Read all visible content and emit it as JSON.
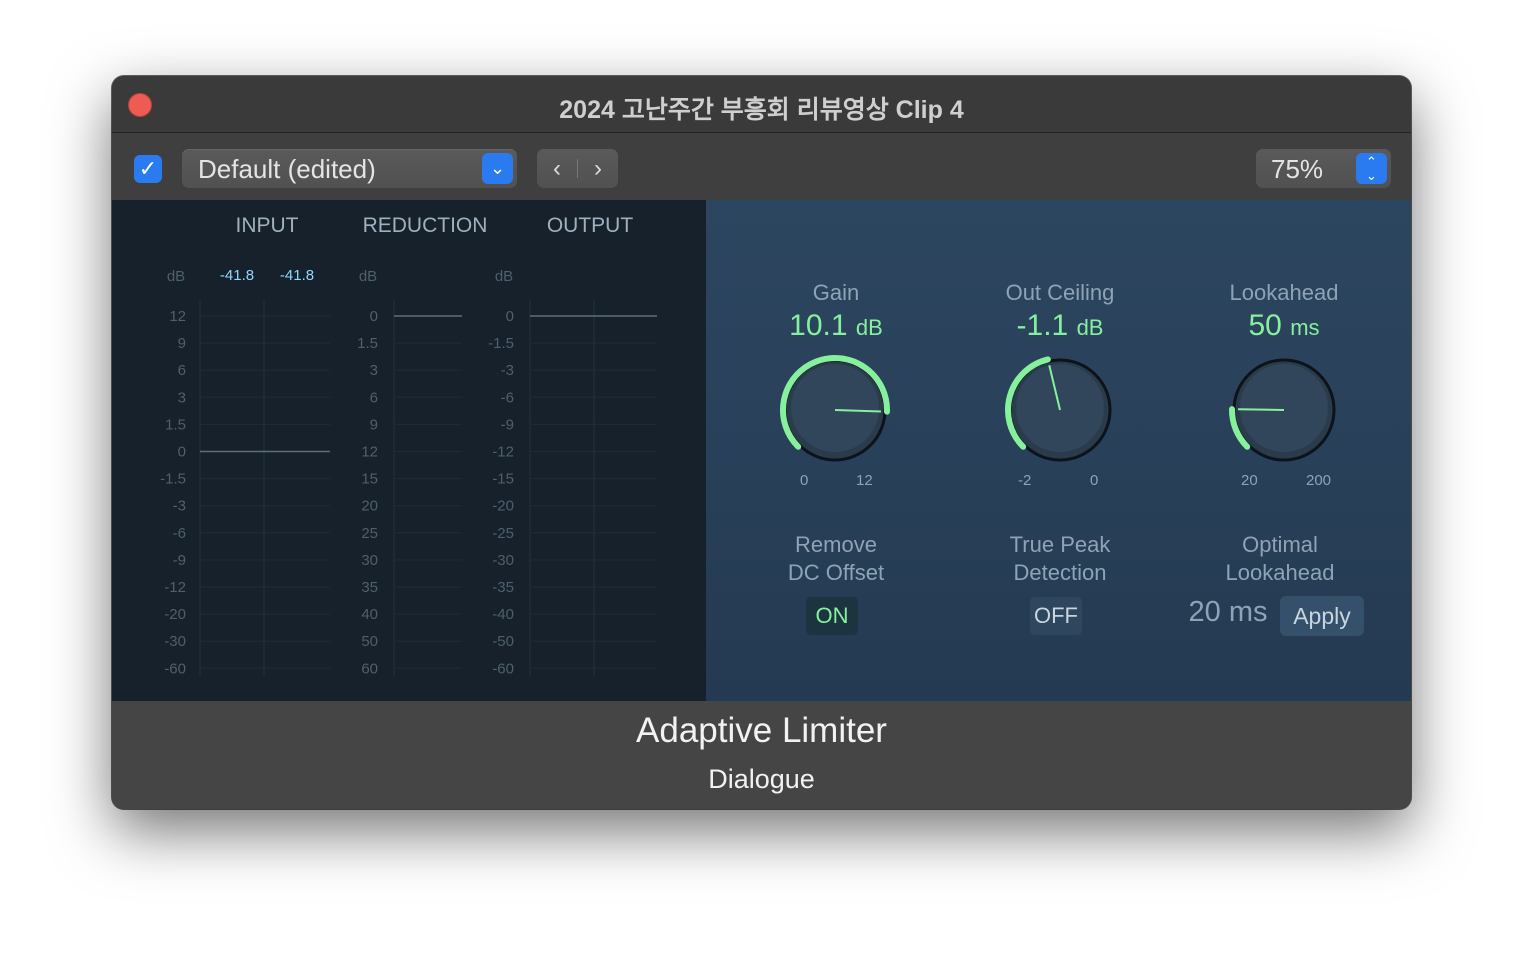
{
  "window": {
    "title": "2024 고난주간 부흥회 리뷰영상 Clip 4"
  },
  "toolbar": {
    "enabled": true,
    "preset": "Default (edited)",
    "prev_icon": "chevron-left-icon",
    "next_icon": "chevron-right-icon",
    "zoom": "75%"
  },
  "meters": {
    "headers": [
      "INPUT",
      "REDUCTION",
      "OUTPUT"
    ],
    "unit_label": "dB",
    "input_peaks": [
      "-41.8",
      "-41.8"
    ],
    "input_scale": [
      "12",
      "9",
      "6",
      "3",
      "1.5",
      "0",
      "-1.5",
      "-3",
      "-6",
      "-9",
      "-12",
      "-20",
      "-30",
      "-60"
    ],
    "reduction_scale": [
      "0",
      "1.5",
      "3",
      "6",
      "9",
      "12",
      "15",
      "20",
      "25",
      "30",
      "35",
      "40",
      "50",
      "60"
    ],
    "output_scale": [
      "0",
      "-1.5",
      "-3",
      "-6",
      "-9",
      "-12",
      "-15",
      "-20",
      "-25",
      "-30",
      "-35",
      "-40",
      "-50",
      "-60"
    ]
  },
  "controls": {
    "gain": {
      "label": "Gain",
      "value": "10.1",
      "unit": "dB",
      "min": "0",
      "max": "12",
      "level": 0.84
    },
    "out_ceiling": {
      "label": "Out Ceiling",
      "value": "-1.1",
      "unit": "dB",
      "min": "-2",
      "max": "0",
      "level": 0.45
    },
    "lookahead": {
      "label": "Lookahead",
      "value": "50",
      "unit": "ms",
      "min": "20",
      "max": "200",
      "level": 0.17
    },
    "remove_dc": {
      "label_line1": "Remove",
      "label_line2": "DC Offset",
      "state": "ON"
    },
    "true_peak": {
      "label_line1": "True Peak",
      "label_line2": "Detection",
      "state": "OFF"
    },
    "optimal_lookahead": {
      "label_line1": "Optimal",
      "label_line2": "Lookahead",
      "value": "20 ms",
      "apply": "Apply"
    }
  },
  "footer": {
    "plugin_name": "Adaptive Limiter",
    "subtitle": "Dialogue"
  },
  "colors": {
    "accent_green": "#86f19c",
    "panel_blue": "#2d4660",
    "meter_bg": "#16212b",
    "system_blue": "#2a7bf0",
    "close_red": "#ed5b52"
  }
}
